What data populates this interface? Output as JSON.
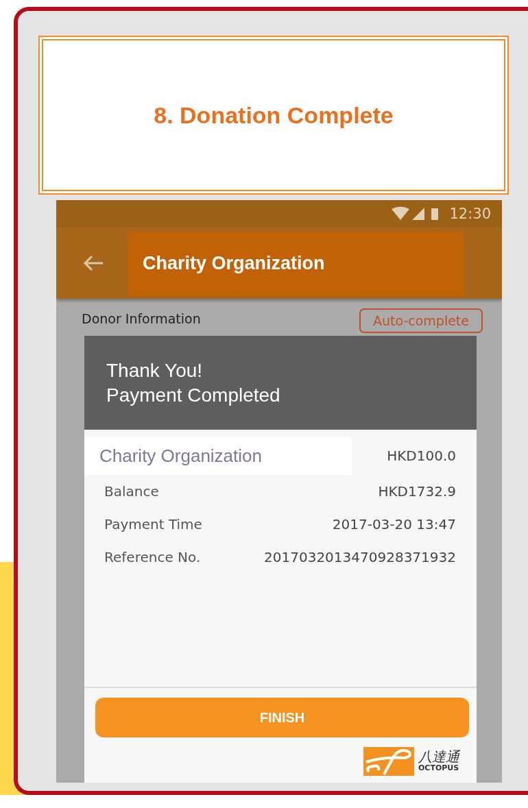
{
  "step_title": "8. Donation Complete",
  "status_bar": {
    "time": "12:30"
  },
  "app_bar": {
    "title": "Charity Organization"
  },
  "form": {
    "section_label": "Donor Information",
    "auto_complete_button": "Auto-complete"
  },
  "dialog": {
    "title_lines": [
      "Thank You!",
      "Payment Completed"
    ],
    "rows": [
      {
        "kind": "highlight",
        "label": "Charity Organization",
        "value": "HKD100.0"
      },
      {
        "kind": "plain",
        "label": "Balance",
        "value": "HKD1732.9"
      },
      {
        "kind": "plain",
        "label": "Payment Time",
        "value": "2017-03-20 13:47"
      },
      {
        "kind": "plain",
        "label": "Reference No.",
        "value": "2017032013470928371932"
      }
    ],
    "button": "FINISH",
    "logo": {
      "chinese": "八達通",
      "english": "OCTOPUS"
    }
  }
}
